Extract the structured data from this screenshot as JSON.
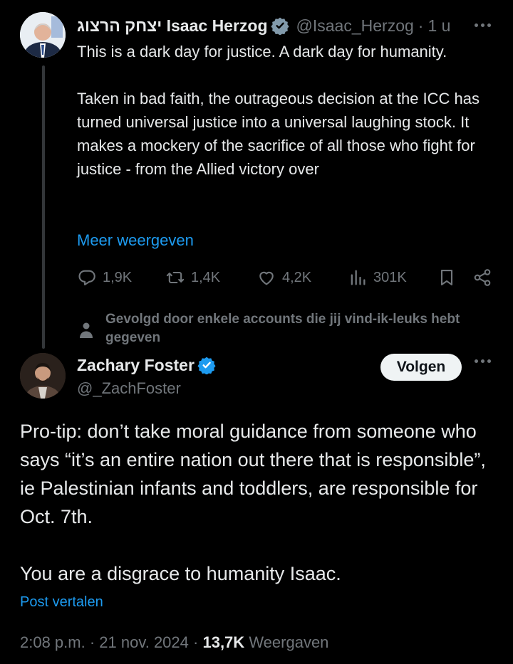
{
  "tweet1": {
    "name": "יצחק הרצוג Isaac Herzog",
    "handle": "@Isaac_Herzog",
    "sep": "·",
    "time": "1 u",
    "text_p1": "This is a dark day for justice. A dark day for humanity.",
    "text_p2": "Taken in bad faith, the outrageous decision at the ICC has turned universal justice into a universal laughing stock. It makes a mockery of the sacrifice of all those who fight for justice - from the Allied victory over",
    "show_more": "Meer weergeven",
    "actions": {
      "replies": "1,9K",
      "reposts": "1,4K",
      "likes": "4,2K",
      "views": "301K"
    }
  },
  "social_context": "Gevolgd door enkele accounts die jij vind-ik-leuks hebt gegeven",
  "tweet2": {
    "name": "Zachary Foster",
    "handle": "@_ZachFoster",
    "follow_label": "Volgen",
    "text_p1": "Pro-tip: don’t take moral guidance from someone who says “it’s an entire nation out there that is responsible”, ie Palestinian infants and toddlers, are responsible for Oct. 7th.",
    "text_p2": "You are a disgrace to humanity Isaac.",
    "translate": "Post vertalen",
    "time": "2:08 p.m.",
    "sep": "·",
    "date": "21 nov. 2024",
    "views_count": "13,7K",
    "views_label": "Weergaven"
  },
  "icons": {
    "verified": "verified-badge-icon",
    "reply": "speech-bubble-icon",
    "repost": "repost-arrows-icon",
    "like": "heart-icon",
    "views": "bar-chart-icon",
    "bookmark": "bookmark-icon",
    "share": "share-icon",
    "more": "more-dots-icon",
    "person": "person-icon"
  },
  "colors": {
    "background": "#000000",
    "text": "#e7e9ea",
    "muted": "#71767b",
    "accent": "#1d9bf0",
    "follow_bg": "#eff3f4"
  }
}
